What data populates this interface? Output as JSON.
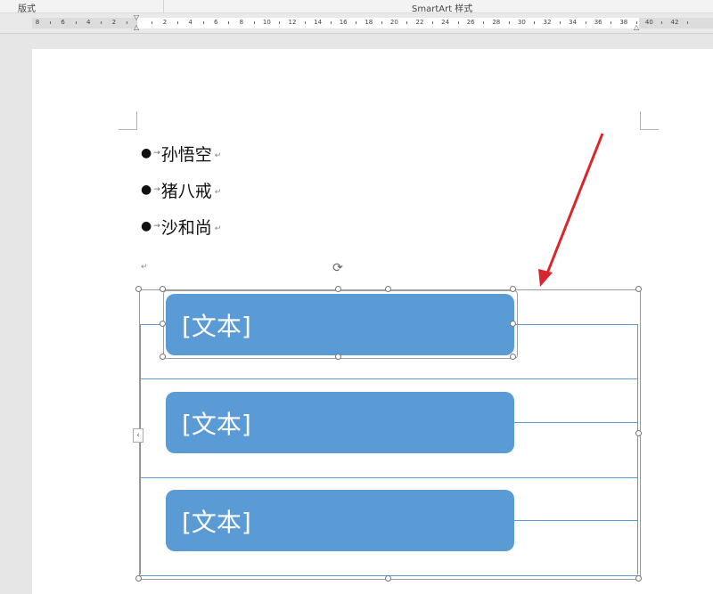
{
  "ribbon": {
    "left_label": "版式",
    "center_label": "SmartArt 样式"
  },
  "ruler": {
    "labels": [
      "8",
      "6",
      "4",
      "2",
      "",
      "2",
      "4",
      "6",
      "8",
      "10",
      "12",
      "14",
      "16",
      "18",
      "20",
      "22",
      "24",
      "26",
      "28",
      "30",
      "32",
      "34",
      "36",
      "38",
      "40",
      "42"
    ]
  },
  "document": {
    "bullets": [
      {
        "text": "孙悟空"
      },
      {
        "text": "猪八戒"
      },
      {
        "text": "沙和尚"
      }
    ],
    "paragraph_mark": "↵",
    "tab_mark": "→",
    "bullet_glyph": "●"
  },
  "smartart": {
    "boxes": [
      {
        "text": "[文本]"
      },
      {
        "text": "[文本]"
      },
      {
        "text": "[文本]"
      }
    ],
    "fill_color": "#5b9bd5"
  },
  "annotation": {
    "arrow_color": "#d9262c"
  }
}
